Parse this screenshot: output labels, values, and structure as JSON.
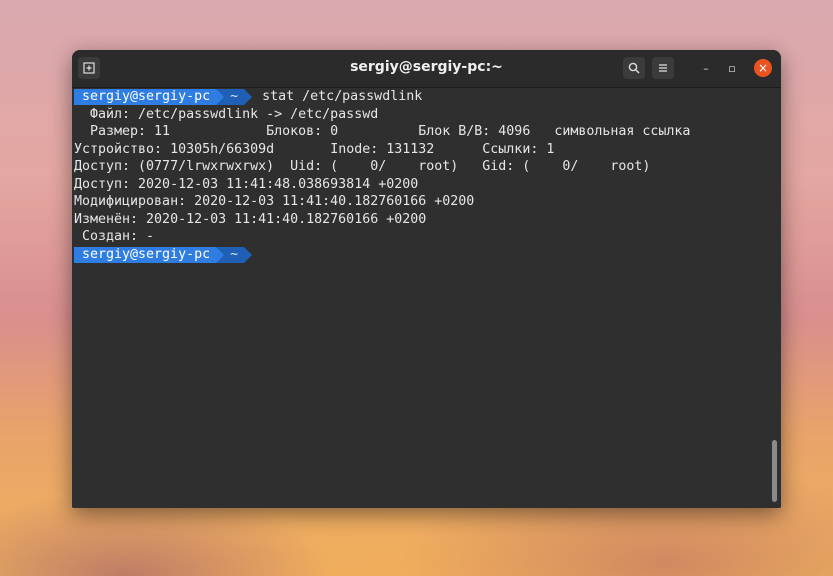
{
  "window": {
    "title": "sergiy@sergiy-pc:~",
    "newtab_icon": "new-tab-icon",
    "search_icon": "search-icon",
    "menu_icon": "hamburger-icon",
    "minimize_glyph": "–",
    "maximize_glyph": "▫",
    "close_glyph": "×"
  },
  "terminal": {
    "prompt1": {
      "user": "sergiy@sergiy-pc",
      "dir": "~",
      "command": "stat /etc/passwdlink"
    },
    "output": [
      "  Файл: /etc/passwdlink -> /etc/passwd",
      "  Размер: 11        \tБлоков: 0          Блок В/В: 4096   символьная ссылка",
      "Устройство: 10305h/66309d\tInode: 131132      Ссылки: 1",
      "Доступ: (0777/lrwxrwxrwx)  Uid: (    0/    root)   Gid: (    0/    root)",
      "Доступ: 2020-12-03 11:41:48.038693814 +0200",
      "Модифицирован: 2020-12-03 11:41:40.182760166 +0200",
      "Изменён: 2020-12-03 11:41:40.182760166 +0200",
      " Создан: -"
    ],
    "prompt2": {
      "user": "sergiy@sergiy-pc",
      "dir": "~"
    }
  },
  "colors": {
    "prompt_user_bg": "#2f7de1",
    "prompt_dir_bg": "#1f5fb5",
    "terminal_bg": "#2f2f2f",
    "close_button": "#e95420"
  }
}
